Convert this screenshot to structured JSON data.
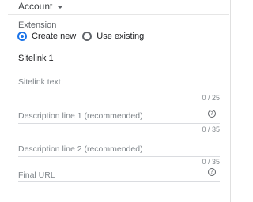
{
  "header": {
    "account_label": "Account"
  },
  "extension": {
    "label": "Extension",
    "options": [
      {
        "label": "Create new",
        "selected": true
      },
      {
        "label": "Use existing",
        "selected": false
      }
    ]
  },
  "sitelink": {
    "title": "Sitelink 1",
    "fields": [
      {
        "placeholder": "Sitelink text",
        "counter": "0 / 25",
        "help": false
      },
      {
        "placeholder": "Description line 1 (recommended)",
        "counter": "0 / 35",
        "help": true
      },
      {
        "placeholder": "Description line 2 (recommended)",
        "counter": "0 / 35",
        "help": false
      },
      {
        "placeholder": "Final URL",
        "counter": "",
        "help": true
      }
    ]
  },
  "colors": {
    "accent": "#1a73e8",
    "divider": "#dadce0",
    "muted_text": "#80868b"
  },
  "icons": {
    "dropdown": "chevron-down-icon",
    "help": "help-icon"
  }
}
